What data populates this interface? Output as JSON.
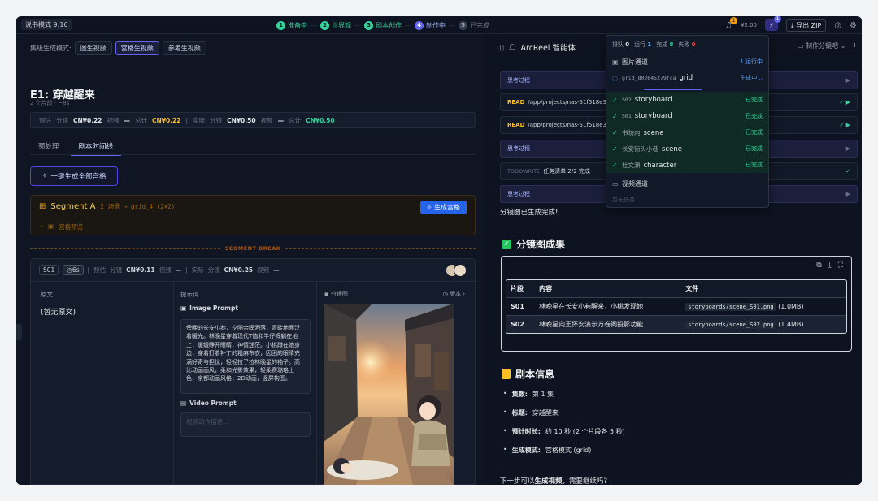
{
  "topbar": {
    "mode": "说书模式 9:16",
    "steps": [
      {
        "num": "1",
        "label": "准备中",
        "state": "green"
      },
      {
        "num": "2",
        "label": "世界观",
        "state": "green"
      },
      {
        "num": "3",
        "label": "剧本创作",
        "state": "green"
      },
      {
        "num": "4",
        "label": "制作中",
        "state": "blue"
      },
      {
        "num": "5",
        "label": "已完成",
        "state": "gray"
      }
    ],
    "bell_badge": "1",
    "cost": "¥2.00",
    "agent_badge": "1",
    "export_label": "导出 ZIP"
  },
  "left": {
    "gen_mode_label": "集级生成模式:",
    "gen_modes": [
      "图生视频",
      "宫格生视频",
      "参考生视频"
    ],
    "episode_title": "E1: 穿越醒来",
    "episode_sub": "2 个片段 · ~8s",
    "cost": {
      "est_label": "预估",
      "storyboard_label": "分镜",
      "storyboard_est": "CN¥0.22",
      "video_label": "视频",
      "video_est": "—",
      "total_label": "总计",
      "total_est": "CN¥0.22",
      "actual_label": "实际",
      "storyboard_actual": "CN¥0.50",
      "video_actual": "—",
      "total_actual": "CN¥0.50"
    },
    "tabs": [
      "预处理",
      "剧本时间线"
    ],
    "generate_all_label": "一键生成全部宫格",
    "segment": {
      "name": "Segment A",
      "meta_prefix": "2 场景 →",
      "meta_grid": "grid_4 (2×2)",
      "button": "生成宫格",
      "preview": "宫格预览"
    },
    "segment_break": "SEGMENT BREAK",
    "shot": {
      "id": "S01",
      "duration": "6s",
      "est_label": "预估",
      "storyboard_label": "分镜",
      "storyboard_est": "CN¥0.11",
      "video_label": "视频",
      "video_est": "—",
      "actual_label": "实际",
      "storyboard_actual": "CN¥0.25",
      "video_actual": "—",
      "source_label": "原文",
      "source_value": "(暂无原文)",
      "prompt_label": "提示词",
      "image_prompt_label": "Image Prompt",
      "image_prompt": "傍晚的长安小巷，夕阳余晖洒落，青砖地面泛着暖光。林晚星穿着现代T恤和牛仔裤躺在地上，缓缓睁开眼睛，神情迷茫。小桃蹲在她身边，穿着打着补丁的粗麻布衣，因困的眼睛充满好奇与担忧，轻轻拉了拉林晚星的袖子。高比动画画风，柔和光影效果，轻柔赛璐珞上色，京都动画风格，2D动画，竖屏构图。",
      "video_prompt_label": "Video Prompt",
      "video_prompt_placeholder": "视频动作描述...",
      "storyboard_label_img": "分镜图",
      "version_label": "版本"
    }
  },
  "right": {
    "title": "ArcReel 智能体",
    "session_label": "制作分镜吧",
    "logs": [
      {
        "type": "think",
        "text": "思考过程"
      },
      {
        "type": "read",
        "key": "READ",
        "text": "/app/projects/nas-51f518e3/storyb"
      },
      {
        "type": "read",
        "key": "READ",
        "text": "/app/projects/nas-51f518e3/storyb"
      },
      {
        "type": "think",
        "text": "思考过程"
      },
      {
        "type": "todo",
        "key": "TODOWRITE",
        "text": "任务清单 2/2 完成"
      },
      {
        "type": "think",
        "text": "思考过程"
      }
    ],
    "done_msg": "分镜图已生成完成!",
    "results_title": "分镜图成果",
    "table": {
      "headers": [
        "片段",
        "内容",
        "文件"
      ],
      "rows": [
        {
          "seg": "S01",
          "content": "林晚星在长安小巷醒来，小桃发现她",
          "file": "storyboards/scene_S01.png",
          "size": "(1.0MB)"
        },
        {
          "seg": "S02",
          "content": "林晚星向王怀安演示万卷阁投影功能",
          "file": "storyboards/scene_S02.png",
          "size": "(1.4MB)"
        }
      ]
    },
    "info_title": "剧本信息",
    "info": [
      {
        "key": "集数:",
        "value": "第 1 集"
      },
      {
        "key": "标题:",
        "value": "穿越醒来"
      },
      {
        "key": "预计时长:",
        "value": "约 10 秒 (2 个片段各 5 秒)"
      },
      {
        "key": "生成模式:",
        "value": "宫格模式 (grid)"
      }
    ],
    "next_prefix": "下一步可以",
    "next_bold": "生成视频",
    "next_suffix": "，需要继续吗?"
  },
  "dropdown": {
    "queue_label": "排队",
    "queue": "0",
    "running_label": "运行",
    "running": "1",
    "done_label": "完成",
    "done": "8",
    "failed_label": "失败",
    "failed": "0",
    "image_channel": "图片通道",
    "image_running": "1 运行中",
    "current_id": "grid_802645279fca",
    "current_kind": "grid",
    "current_state": "生成中...",
    "tasks": [
      {
        "id": "S02",
        "kind": "storyboard",
        "state": "已完成"
      },
      {
        "id": "S01",
        "kind": "storyboard",
        "state": "已完成"
      },
      {
        "id": "书坊内",
        "kind": "scene",
        "state": "已完成"
      },
      {
        "id": "长安街头小巷",
        "kind": "scene",
        "state": "已完成"
      },
      {
        "id": "杜文渊",
        "kind": "character",
        "state": "已完成"
      }
    ],
    "video_channel": "视频通道",
    "no_task": "暂无任务"
  }
}
